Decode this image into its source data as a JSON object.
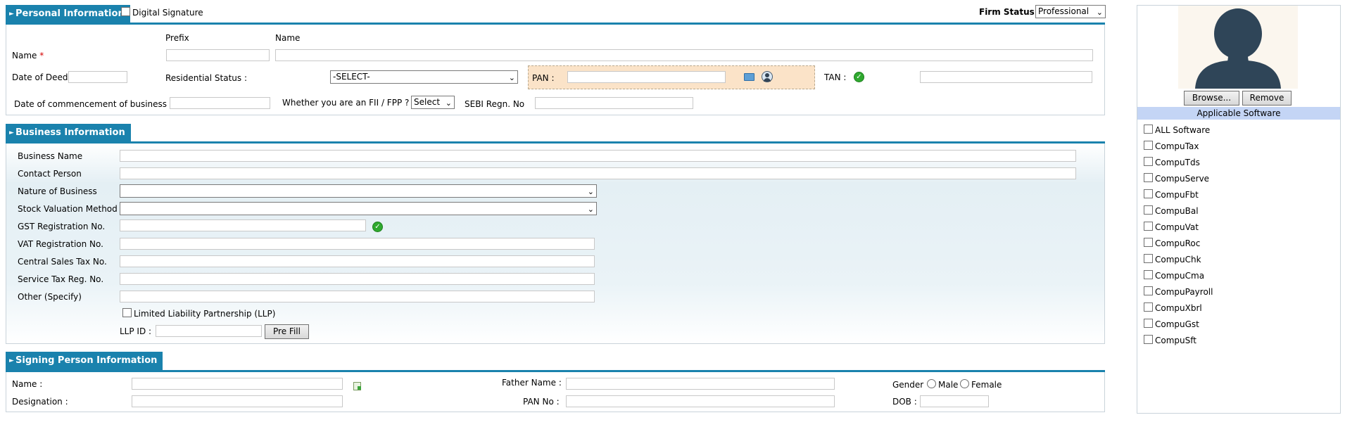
{
  "personal": {
    "tab_label": "Personal Information",
    "digital_signature_label": "Digital Signature",
    "firm_status_label": "Firm Status",
    "firm_status_value": "Professional",
    "prefix_header": "Prefix",
    "name_header": "Name",
    "name_label": "Name",
    "required_mark": "*",
    "date_of_deed_label": "Date of Deed",
    "residential_status_label": "Residential Status :",
    "residential_status_value": "-SELECT-",
    "pan_label": "PAN :",
    "tan_label": "TAN :",
    "commencement_label": "Date of commencement of business :",
    "fii_label": "Whether you are an FII / FPP ?",
    "fii_value": "Select",
    "sebi_label": "SEBI Regn. No"
  },
  "business": {
    "tab_label": "Business Information",
    "business_name_label": "Business Name",
    "contact_person_label": "Contact Person",
    "nature_label": "Nature of Business",
    "stock_valuation_label": "Stock Valuation Method",
    "gst_label": "GST Registration No.",
    "vat_label": "VAT Registration No.",
    "cst_label": "Central Sales Tax No.",
    "service_tax_label": "Service Tax Reg. No.",
    "other_label": "Other (Specify)",
    "llp_label": "Limited Liability Partnership (LLP)",
    "llp_id_label": "LLP ID :",
    "prefill_label": "Pre Fill"
  },
  "signing": {
    "tab_label": "Signing Person Information",
    "name_label": "Name :",
    "designation_label": "Designation :",
    "father_name_label": "Father Name :",
    "pan_no_label": "PAN No :",
    "gender_label": "Gender",
    "male_label": "Male",
    "female_label": "Female",
    "dob_label": "DOB :"
  },
  "side": {
    "browse_label": "Browse...",
    "remove_label": "Remove",
    "applicable_software_label": "Applicable Software",
    "software": [
      "ALL Software",
      "CompuTax",
      "CompuTds",
      "CompuServe",
      "CompuFbt",
      "CompuBal",
      "CompuVat",
      "CompuRoc",
      "CompuChk",
      "CompuCma",
      "CompuPayroll",
      "CompuXbrl",
      "CompuGst",
      "CompuSft"
    ]
  },
  "colors": {
    "section_accent": "#1a82ad",
    "pan_highlight": "#fbe3c8",
    "applicable_header_bg": "#c4d5f5",
    "avatar": "#2f4558",
    "ok_green": "#2fa92f"
  }
}
